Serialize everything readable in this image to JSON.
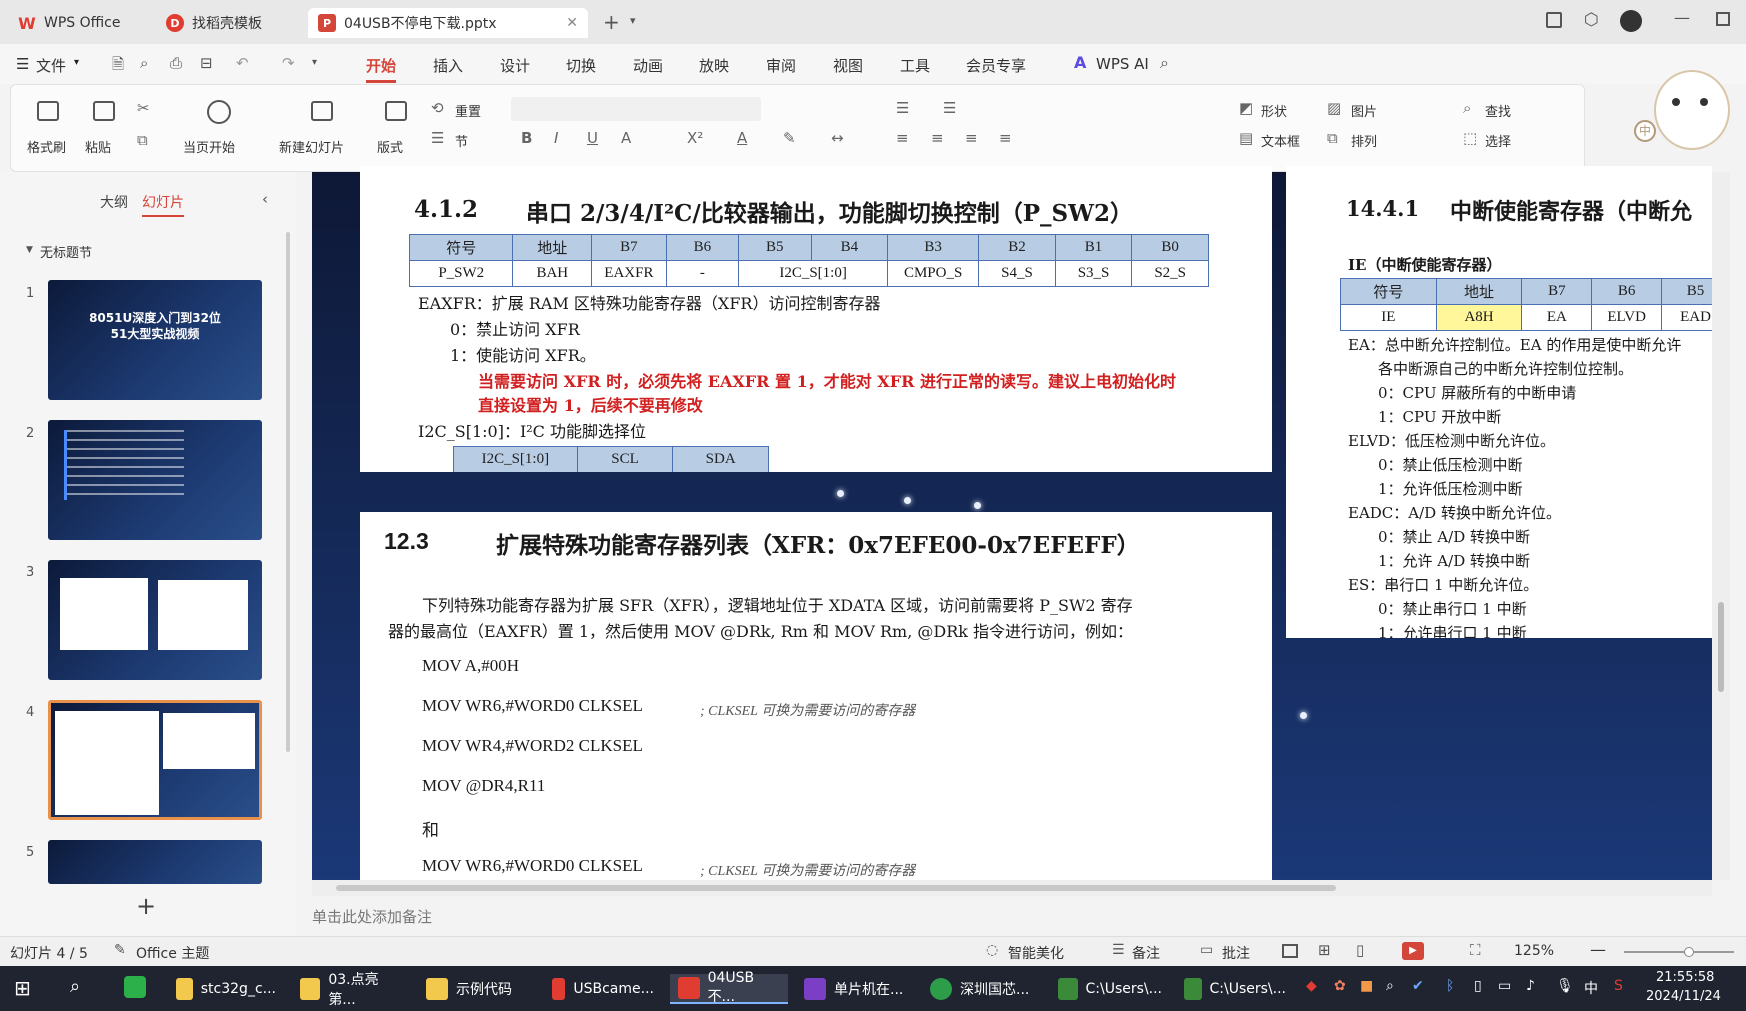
{
  "window": {
    "tabs": [
      {
        "label": "WPS Office",
        "active": false
      },
      {
        "label": "找稻壳模板",
        "active": false
      },
      {
        "label": "04USB不停电下载.pptx",
        "active": true
      }
    ]
  },
  "menu": {
    "file": "文件",
    "items": [
      "开始",
      "插入",
      "设计",
      "切换",
      "动画",
      "放映",
      "审阅",
      "视图",
      "工具",
      "会员专享"
    ],
    "active": "开始",
    "ai": "WPS AI"
  },
  "ribbon": {
    "format_painter": "格式刷",
    "paste": "粘贴",
    "from_current": "当页开始",
    "new_slide": "新建幻灯片",
    "layout": "版式",
    "reset": "重置",
    "section": "节",
    "shape": "形状",
    "picture": "图片",
    "find": "查找",
    "textbox": "文本框",
    "arrange": "排列",
    "select": "选择"
  },
  "sidebar": {
    "tab_outline": "大纲",
    "tab_slides": "幻灯片",
    "section_title": "无标题节",
    "slides": [
      "1",
      "2",
      "3",
      "4",
      "5"
    ],
    "selected": "4",
    "slide1_title": "8051U深度入门到32位\n51大型实战视频",
    "add": "+"
  },
  "slide": {
    "p1": {
      "num": "4.1.2",
      "title": "串口 2/3/4/I²C/比较器输出，功能脚切换控制（P_SW2）",
      "header": [
        "符号",
        "地址",
        "B7",
        "B6",
        "B5",
        "B4",
        "B3",
        "B2",
        "B1",
        "B0"
      ],
      "row": [
        "P_SW2",
        "BAH",
        "EAXFR",
        "-",
        "I2C_S[1:0]",
        "CMPO_S",
        "S4_S",
        "S3_S",
        "S2_S"
      ],
      "l1": "EAXFR：扩展 RAM 区特殊功能寄存器（XFR）访问控制寄存器",
      "l2": "0：禁止访问 XFR",
      "l3": "1：使能访问 XFR。",
      "warn1": "当需要访问 XFR 时，必须先将 EAXFR 置 1，才能对 XFR 进行正常的读写。建议上电初始化时",
      "warn2": "直接设置为 1，后续不要再修改",
      "l4": "I2C_S[1:0]：I²C 功能脚选择位",
      "sub": [
        "I2C_S[1:0]",
        "SCL",
        "SDA"
      ]
    },
    "p2": {
      "num": "12.3",
      "title": "扩展特殊功能寄存器列表（XFR：0x7EFE00-0x7EFEFF）",
      "para1": "下列特殊功能寄存器为扩展 SFR（XFR），逻辑地址位于 XDATA 区域，访问前需要将 P_SW2 寄存",
      "para2": "器的最高位（EAXFR）置 1，然后使用 MOV @DRk, Rm 和 MOV Rm, @DRk 指令进行访问，例如：",
      "code": [
        "MOV   A,#00H",
        "MOV   WR6,#WORD0 CLKSEL",
        "MOV   WR4,#WORD2 CLKSEL",
        "MOV   @DR4,R11",
        "和",
        "MOV   WR6,#WORD0 CLKSEL"
      ],
      "comment": "; CLKSEL 可换为需要访问的寄存器"
    },
    "p3": {
      "num": "14.4.1",
      "title": "中断使能寄存器（中断允",
      "caption": "IE（中断使能寄存器）",
      "header": [
        "符号",
        "地址",
        "B7",
        "B6",
        "B5"
      ],
      "row": [
        "IE",
        "A8H",
        "EA",
        "ELVD",
        "EAD"
      ],
      "lines": [
        "EA：总中断允许控制位。EA 的作用是使中断允许",
        "各中断源自己的中断允许控制位控制。",
        "0：CPU 屏蔽所有的中断申请",
        "1：CPU 开放中断",
        "ELVD：低压检测中断允许位。",
        "0：禁止低压检测中断",
        "1：允许低压检测中断",
        "EADC：A/D 转换中断允许位。",
        "0：禁止 A/D 转换中断",
        "1：允许 A/D 转换中断",
        "ES：串行口 1 中断允许位。",
        "0：禁止串行口 1 中断",
        "1：允许串行口 1 中断"
      ]
    }
  },
  "notes": {
    "placeholder": "单击此处添加备注"
  },
  "status": {
    "slide_info": "幻灯片 4 / 5",
    "theme": "Office 主题",
    "beautify": "智能美化",
    "notes": "备注",
    "comment": "批注",
    "zoom": "125%"
  },
  "taskbar": {
    "items": [
      "stc32g_c...",
      "03.点亮第...",
      "示例代码",
      "USBcame...",
      "04USB不...",
      "单片机在...",
      "深圳国芯...",
      "C:\\Users\\...",
      "C:\\Users\\..."
    ],
    "active": "04USB不...",
    "ime": "中",
    "time": "21:55:58",
    "date": "2024/11/24"
  },
  "colors": {
    "accent_red": "#d21f1f",
    "wps_red": "#e03c31",
    "table_header": "#b8cce4"
  }
}
